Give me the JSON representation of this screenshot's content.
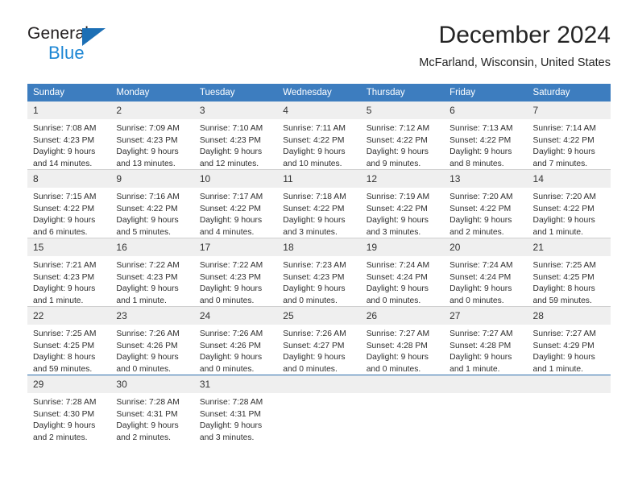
{
  "logo": {
    "word_one": "General",
    "word_two": "Blue",
    "triangle": "blue-triangle-icon",
    "brand_blue": "#1c86d4",
    "triangle_blue": "#1c6fb5"
  },
  "header": {
    "title": "December 2024",
    "subtitle": "McFarland, Wisconsin, United States"
  },
  "colors": {
    "header_row_bg": "#3d7dbf",
    "header_row_text": "#ffffff",
    "daynum_bg": "#efefef",
    "week_divider": "#cfcfcf",
    "last_week_divider": "#2b6cad"
  },
  "weekday_headers": [
    "Sunday",
    "Monday",
    "Tuesday",
    "Wednesday",
    "Thursday",
    "Friday",
    "Saturday"
  ],
  "labels": {
    "sunrise_prefix": "Sunrise:",
    "sunset_prefix": "Sunset:",
    "daylight_prefix": "Daylight:"
  },
  "weeks": [
    [
      {
        "day": "1",
        "sunrise": "Sunrise: 7:08 AM",
        "sunset": "Sunset: 4:23 PM",
        "daylight": "Daylight: 9 hours and 14 minutes."
      },
      {
        "day": "2",
        "sunrise": "Sunrise: 7:09 AM",
        "sunset": "Sunset: 4:23 PM",
        "daylight": "Daylight: 9 hours and 13 minutes."
      },
      {
        "day": "3",
        "sunrise": "Sunrise: 7:10 AM",
        "sunset": "Sunset: 4:23 PM",
        "daylight": "Daylight: 9 hours and 12 minutes."
      },
      {
        "day": "4",
        "sunrise": "Sunrise: 7:11 AM",
        "sunset": "Sunset: 4:22 PM",
        "daylight": "Daylight: 9 hours and 10 minutes."
      },
      {
        "day": "5",
        "sunrise": "Sunrise: 7:12 AM",
        "sunset": "Sunset: 4:22 PM",
        "daylight": "Daylight: 9 hours and 9 minutes."
      },
      {
        "day": "6",
        "sunrise": "Sunrise: 7:13 AM",
        "sunset": "Sunset: 4:22 PM",
        "daylight": "Daylight: 9 hours and 8 minutes."
      },
      {
        "day": "7",
        "sunrise": "Sunrise: 7:14 AM",
        "sunset": "Sunset: 4:22 PM",
        "daylight": "Daylight: 9 hours and 7 minutes."
      }
    ],
    [
      {
        "day": "8",
        "sunrise": "Sunrise: 7:15 AM",
        "sunset": "Sunset: 4:22 PM",
        "daylight": "Daylight: 9 hours and 6 minutes."
      },
      {
        "day": "9",
        "sunrise": "Sunrise: 7:16 AM",
        "sunset": "Sunset: 4:22 PM",
        "daylight": "Daylight: 9 hours and 5 minutes."
      },
      {
        "day": "10",
        "sunrise": "Sunrise: 7:17 AM",
        "sunset": "Sunset: 4:22 PM",
        "daylight": "Daylight: 9 hours and 4 minutes."
      },
      {
        "day": "11",
        "sunrise": "Sunrise: 7:18 AM",
        "sunset": "Sunset: 4:22 PM",
        "daylight": "Daylight: 9 hours and 3 minutes."
      },
      {
        "day": "12",
        "sunrise": "Sunrise: 7:19 AM",
        "sunset": "Sunset: 4:22 PM",
        "daylight": "Daylight: 9 hours and 3 minutes."
      },
      {
        "day": "13",
        "sunrise": "Sunrise: 7:20 AM",
        "sunset": "Sunset: 4:22 PM",
        "daylight": "Daylight: 9 hours and 2 minutes."
      },
      {
        "day": "14",
        "sunrise": "Sunrise: 7:20 AM",
        "sunset": "Sunset: 4:22 PM",
        "daylight": "Daylight: 9 hours and 1 minute."
      }
    ],
    [
      {
        "day": "15",
        "sunrise": "Sunrise: 7:21 AM",
        "sunset": "Sunset: 4:23 PM",
        "daylight": "Daylight: 9 hours and 1 minute."
      },
      {
        "day": "16",
        "sunrise": "Sunrise: 7:22 AM",
        "sunset": "Sunset: 4:23 PM",
        "daylight": "Daylight: 9 hours and 1 minute."
      },
      {
        "day": "17",
        "sunrise": "Sunrise: 7:22 AM",
        "sunset": "Sunset: 4:23 PM",
        "daylight": "Daylight: 9 hours and 0 minutes."
      },
      {
        "day": "18",
        "sunrise": "Sunrise: 7:23 AM",
        "sunset": "Sunset: 4:23 PM",
        "daylight": "Daylight: 9 hours and 0 minutes."
      },
      {
        "day": "19",
        "sunrise": "Sunrise: 7:24 AM",
        "sunset": "Sunset: 4:24 PM",
        "daylight": "Daylight: 9 hours and 0 minutes."
      },
      {
        "day": "20",
        "sunrise": "Sunrise: 7:24 AM",
        "sunset": "Sunset: 4:24 PM",
        "daylight": "Daylight: 9 hours and 0 minutes."
      },
      {
        "day": "21",
        "sunrise": "Sunrise: 7:25 AM",
        "sunset": "Sunset: 4:25 PM",
        "daylight": "Daylight: 8 hours and 59 minutes."
      }
    ],
    [
      {
        "day": "22",
        "sunrise": "Sunrise: 7:25 AM",
        "sunset": "Sunset: 4:25 PM",
        "daylight": "Daylight: 8 hours and 59 minutes."
      },
      {
        "day": "23",
        "sunrise": "Sunrise: 7:26 AM",
        "sunset": "Sunset: 4:26 PM",
        "daylight": "Daylight: 9 hours and 0 minutes."
      },
      {
        "day": "24",
        "sunrise": "Sunrise: 7:26 AM",
        "sunset": "Sunset: 4:26 PM",
        "daylight": "Daylight: 9 hours and 0 minutes."
      },
      {
        "day": "25",
        "sunrise": "Sunrise: 7:26 AM",
        "sunset": "Sunset: 4:27 PM",
        "daylight": "Daylight: 9 hours and 0 minutes."
      },
      {
        "day": "26",
        "sunrise": "Sunrise: 7:27 AM",
        "sunset": "Sunset: 4:28 PM",
        "daylight": "Daylight: 9 hours and 0 minutes."
      },
      {
        "day": "27",
        "sunrise": "Sunrise: 7:27 AM",
        "sunset": "Sunset: 4:28 PM",
        "daylight": "Daylight: 9 hours and 1 minute."
      },
      {
        "day": "28",
        "sunrise": "Sunrise: 7:27 AM",
        "sunset": "Sunset: 4:29 PM",
        "daylight": "Daylight: 9 hours and 1 minute."
      }
    ],
    [
      {
        "day": "29",
        "sunrise": "Sunrise: 7:28 AM",
        "sunset": "Sunset: 4:30 PM",
        "daylight": "Daylight: 9 hours and 2 minutes."
      },
      {
        "day": "30",
        "sunrise": "Sunrise: 7:28 AM",
        "sunset": "Sunset: 4:31 PM",
        "daylight": "Daylight: 9 hours and 2 minutes."
      },
      {
        "day": "31",
        "sunrise": "Sunrise: 7:28 AM",
        "sunset": "Sunset: 4:31 PM",
        "daylight": "Daylight: 9 hours and 3 minutes."
      },
      {
        "day": "",
        "sunrise": "",
        "sunset": "",
        "daylight": ""
      },
      {
        "day": "",
        "sunrise": "",
        "sunset": "",
        "daylight": ""
      },
      {
        "day": "",
        "sunrise": "",
        "sunset": "",
        "daylight": ""
      },
      {
        "day": "",
        "sunrise": "",
        "sunset": "",
        "daylight": ""
      }
    ]
  ]
}
